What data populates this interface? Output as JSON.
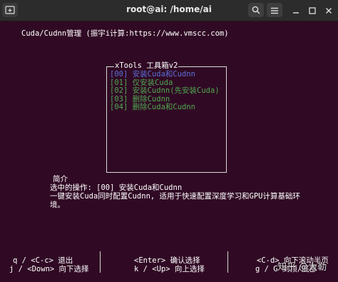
{
  "window": {
    "title": "root@ai: /home/ai"
  },
  "header": {
    "line": "Cuda/Cudnn管理 (振宇i计算:https://www.vmscc.com)"
  },
  "dialog": {
    "title": "xTools 工具箱v2",
    "items": [
      {
        "label": "[00] 安装Cuda和Cudnn",
        "selected": true
      },
      {
        "label": "[01] 仅安装Cuda",
        "selected": false
      },
      {
        "label": "[02] 安装Cudnn(先安装Cuda)",
        "selected": false
      },
      {
        "label": "[03] 删除Cudnn",
        "selected": false
      },
      {
        "label": "[04] 删除Cuda和Cudnn",
        "selected": false
      }
    ]
  },
  "description": {
    "title": "简介",
    "selected_line": "选中的操作: [00] 安装Cuda和Cudnn",
    "body_line1": "一键安装Cuda同时配置Cudnn, 适用于快速配置深度学习和GPU计算基础环",
    "body_line2": "境。"
  },
  "footer": {
    "left1": "q / <C-c> 退出",
    "left2": "j / <Down> 向下选择",
    "mid1": "<Enter> 确认选择",
    "mid2": "k / <Up> 向上选择",
    "right1": "<C-d> 向下滚动半页",
    "right2": "g / G 到顶/底部"
  },
  "watermark": "知乎 @大勒",
  "colors": {
    "terminal_bg": "#300a24",
    "selected": "#5c6fd6",
    "item": "#4fa84f"
  },
  "icons": [
    "new-tab-icon",
    "search-icon",
    "hamburger-menu-icon",
    "minimize-icon",
    "maximize-icon",
    "close-icon"
  ]
}
